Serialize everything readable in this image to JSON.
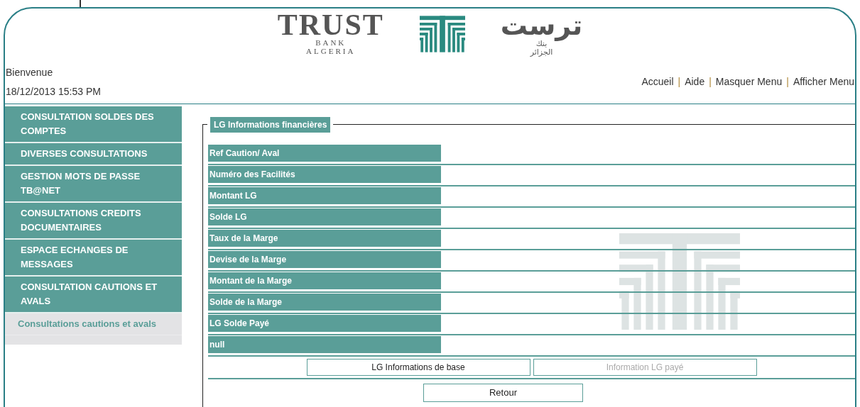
{
  "logo": {
    "latin_name": "TRUST",
    "latin_sub": [
      "BANK",
      "ALGERIA"
    ],
    "arabic_name": "ترست",
    "arabic_sub": [
      "بنك",
      "الجزائر"
    ]
  },
  "welcome": "Bienvenue",
  "datetime": "18/12/2013 15:53 PM",
  "top_links": [
    "Accueil",
    "Aide",
    "Masquer Menu",
    "Afficher Menu"
  ],
  "link_separator": "|",
  "sidebar": {
    "items": [
      {
        "label": "CONSULTATION SOLDES DES COMPTES",
        "kind": "section"
      },
      {
        "label": "DIVERSES CONSULTATIONS",
        "kind": "section"
      },
      {
        "label": "GESTION MOTS DE PASSE TB@NET",
        "kind": "section"
      },
      {
        "label": "CONSULTATIONS CREDITS DOCUMENTAIRES",
        "kind": "section"
      },
      {
        "label": "ESPACE ECHANGES DE MESSAGES",
        "kind": "section"
      },
      {
        "label": "CONSULTATION CAUTIONS ET AVALS",
        "kind": "section"
      },
      {
        "label": "Consultations cautions et avals",
        "kind": "sub"
      }
    ]
  },
  "panel": {
    "legend": "LG Informations financières",
    "fields": [
      "Ref Caution/ Aval",
      "Numéro des Facilités",
      "Montant LG",
      "Solde LG",
      "Taux de la Marge",
      "Devise de la Marge",
      "Montant de la Marge",
      "Solde de la Marge",
      "LG Solde Payé",
      "null"
    ],
    "tab_buttons": [
      {
        "label": "LG Informations de base",
        "disabled": false
      },
      {
        "label": "Information LG payé",
        "disabled": true
      }
    ],
    "back_button": "Retour"
  }
}
